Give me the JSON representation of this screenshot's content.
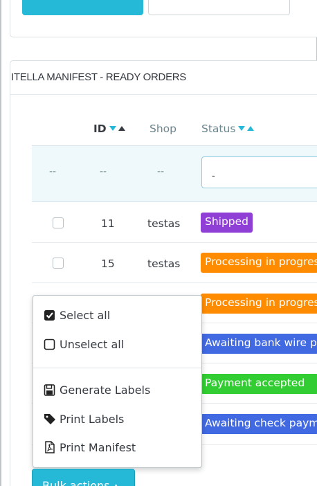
{
  "panel": {
    "title": "ITELLA MANIFEST - READY ORDERS"
  },
  "table": {
    "headers": {
      "id": "ID",
      "shop": "Shop",
      "status": "Status"
    },
    "filters": {
      "checkbox": "--",
      "id": "--",
      "shop": "--",
      "status_value": "-"
    },
    "rows": [
      {
        "id": "11",
        "shop": "testas",
        "status": "Shipped",
        "color": "#8f3fd6"
      },
      {
        "id": "15",
        "shop": "testas",
        "status": "Processing in progress",
        "color": "#ff8c00"
      },
      {
        "status": "Processing in progress",
        "color": "#ff8c00"
      },
      {
        "status": "Awaiting bank wire payment",
        "color": "#4169e1"
      },
      {
        "status": "Payment accepted",
        "color": "#32cd32"
      },
      {
        "status": "Awaiting check payment",
        "color": "#4169e1"
      }
    ]
  },
  "bulk_menu": {
    "select_all": "Select all",
    "unselect_all": "Unselect all",
    "generate_labels": "Generate Labels",
    "print_labels": "Print Labels",
    "print_manifest": "Print Manifest",
    "button_label": "Bulk actions ▴"
  },
  "colors": {
    "accent": "#25b9d7",
    "text": "#363a41",
    "muted": "#6c868e"
  }
}
